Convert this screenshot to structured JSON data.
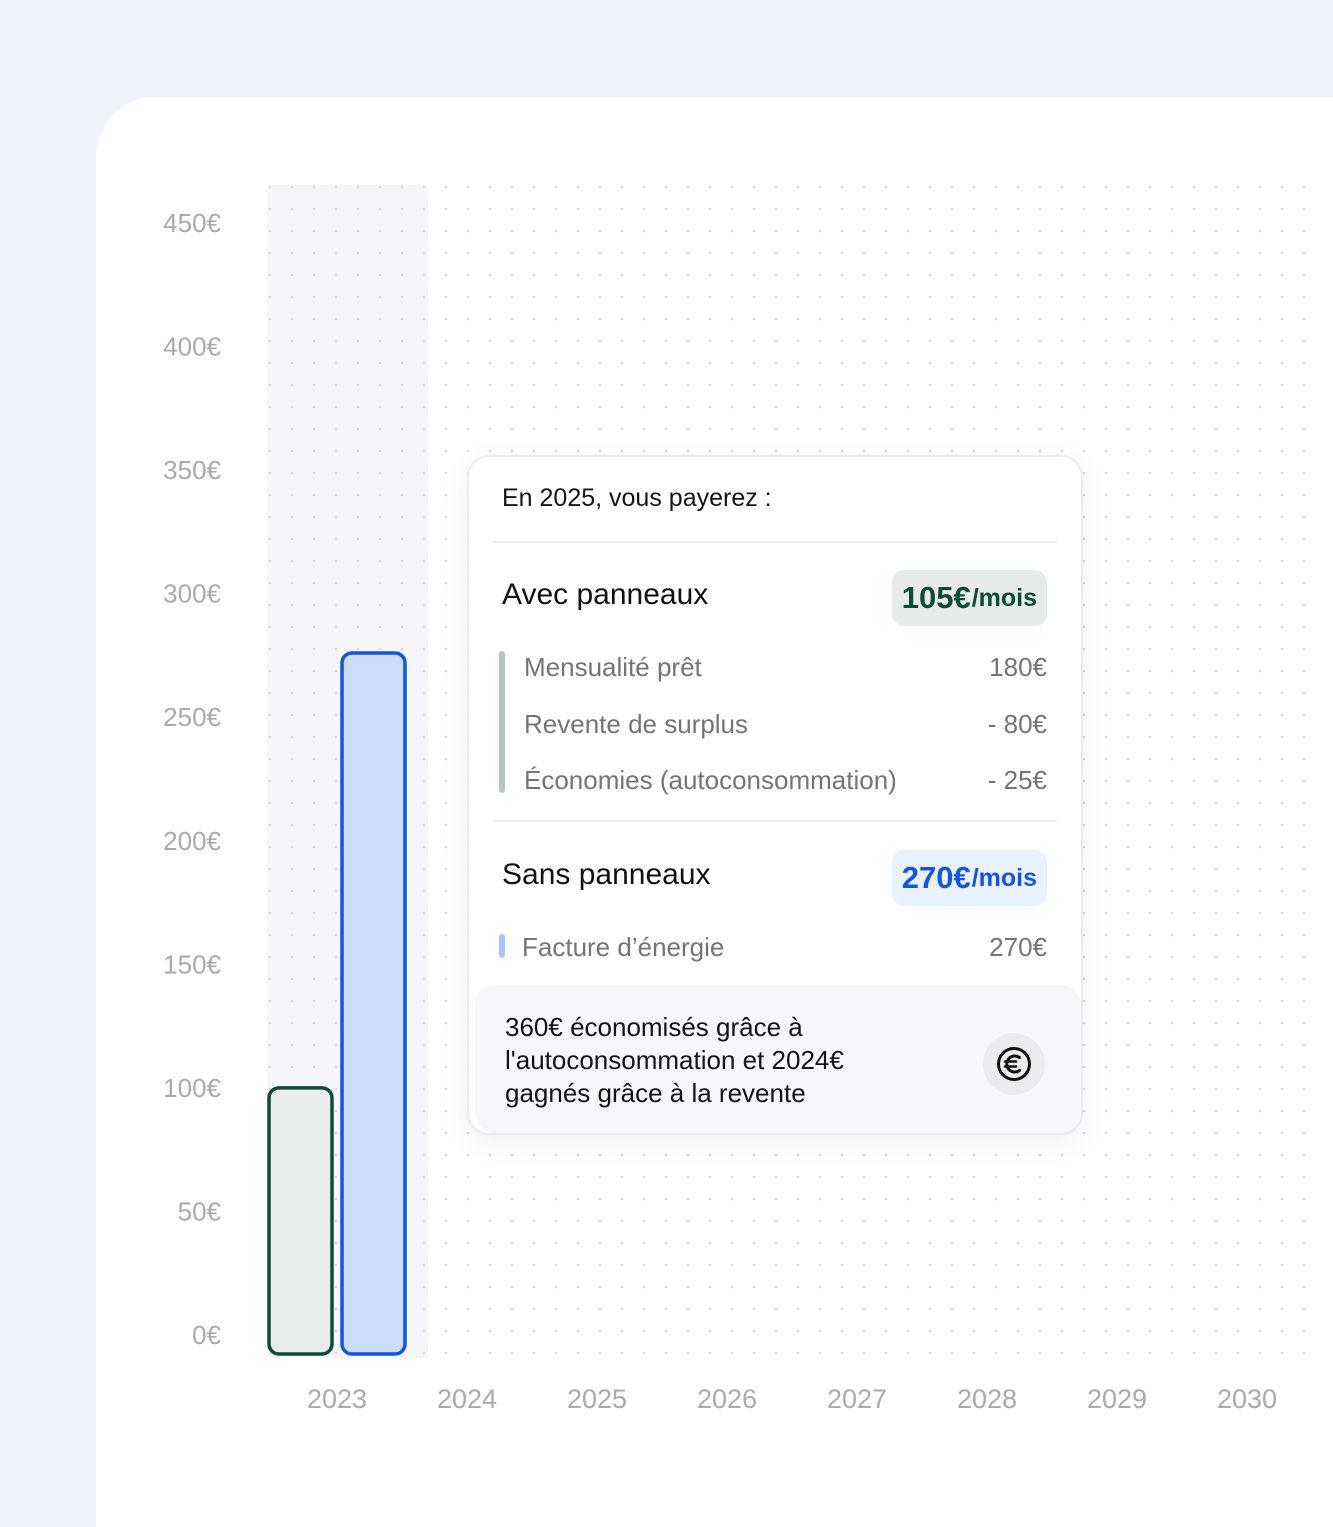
{
  "chart_data": {
    "type": "bar",
    "categories": [
      "2023",
      "2024",
      "2025",
      "2026",
      "2027",
      "2028",
      "2029",
      "2030"
    ],
    "series": [
      {
        "name": "Avec panneaux",
        "color": "#0e4a38",
        "fill": "#e8ecea",
        "values": [
          100,
          null,
          null,
          null,
          null,
          null,
          null,
          null
        ]
      },
      {
        "name": "Sans panneaux",
        "color": "#1356d9",
        "fill": "#cbdcfd",
        "values": [
          276,
          null,
          null,
          null,
          null,
          null,
          null,
          null
        ]
      }
    ],
    "ylim": [
      0,
      450
    ],
    "yticks": [
      0,
      50,
      100,
      150,
      200,
      250,
      300,
      350,
      400,
      450
    ],
    "ytick_labels": [
      "0€",
      "50€",
      "100€",
      "150€",
      "200€",
      "250€",
      "300€",
      "350€",
      "400€",
      "450€"
    ],
    "highlighted_category": "2023",
    "grid": "dotted"
  },
  "tooltip": {
    "title": "En 2025, vous payerez :",
    "with_panels": {
      "label": "Avec panneaux",
      "amount": "105€",
      "unit": "/mois",
      "items": [
        {
          "label": "Mensualité prêt",
          "value": "180€"
        },
        {
          "label": "Revente de surplus",
          "value": "- 80€"
        },
        {
          "label": "Économies (autoconsommation)",
          "value": "- 25€"
        }
      ]
    },
    "without_panels": {
      "label": "Sans panneaux",
      "amount": "270€",
      "unit": "/mois",
      "items": [
        {
          "label": "Facture d’énergie",
          "value": "270€"
        }
      ]
    },
    "summary": "360€ économisés grâce à l'autoconsommation et 2024€ gagnés grâce à la revente",
    "summary_icon": "euro-icon"
  },
  "colors": {
    "green": "#0e4a38",
    "blue": "#1356d9",
    "green_bg": "#e7ecea",
    "blue_bg": "#eaf1fe",
    "accent_bar_green": "#b7c5c0",
    "accent_bar_blue": "#a8c4fb"
  }
}
